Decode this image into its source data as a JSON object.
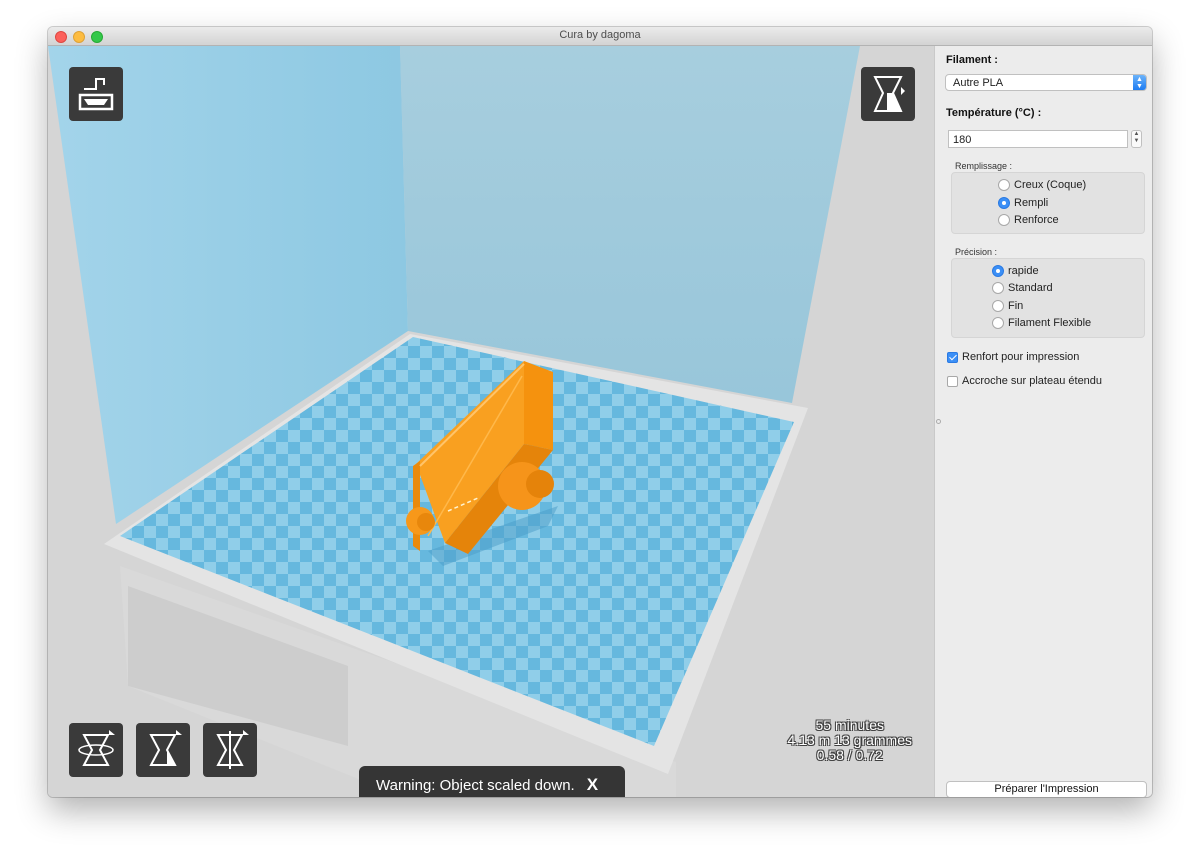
{
  "window": {
    "title": "Cura by dagoma"
  },
  "viewport": {
    "stats": {
      "time": "55 minutes",
      "material": "4.13 m 13 grammes",
      "cost": "0.58 / 0.72"
    },
    "warning": {
      "message": "Warning: Object scaled down.",
      "close": "X"
    }
  },
  "panel": {
    "filament_label": "Filament :",
    "filament_value": "Autre PLA",
    "temperature_label": "Température (°C) :",
    "temperature_value": "180",
    "fill": {
      "label": "Remplissage :",
      "options": [
        {
          "label": "Creux (Coque)",
          "selected": false
        },
        {
          "label": "Rempli",
          "selected": true
        },
        {
          "label": "Renforce",
          "selected": false
        }
      ]
    },
    "precision": {
      "label": "Précision :",
      "options": [
        {
          "label": "rapide",
          "selected": true
        },
        {
          "label": "Standard",
          "selected": false
        },
        {
          "label": "Fin",
          "selected": false
        },
        {
          "label": "Filament Flexible",
          "selected": false
        }
      ]
    },
    "support": {
      "label": "Renfort pour impression",
      "checked": true
    },
    "brim": {
      "label": "Accroche sur plateau étendu",
      "checked": false
    },
    "prepare_button": "Préparer l'Impression"
  },
  "colors": {
    "accent": "#3b8ff6",
    "model": "#f99c12",
    "bed_blue": "#66c0e6",
    "wall_blue": "#9ccfe3"
  }
}
